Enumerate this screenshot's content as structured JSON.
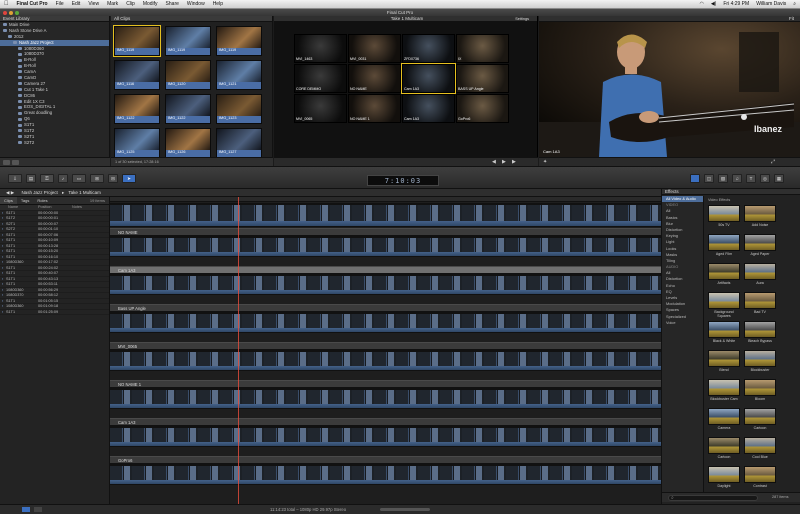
{
  "menubar": {
    "app": "Final Cut Pro",
    "items": [
      "File",
      "Edit",
      "View",
      "Mark",
      "Clip",
      "Modify",
      "Share",
      "Window",
      "Help"
    ],
    "clock": "Fri 4:29 PM",
    "user": "William Davis"
  },
  "window_title": "Final Cut Pro",
  "library": {
    "header": "Event Library",
    "items": [
      {
        "label": "Main Drive",
        "level": 0
      },
      {
        "label": "Nash Stone Drive A",
        "level": 0
      },
      {
        "label": "2012",
        "level": 1
      },
      {
        "label": "Nash Jazz Project",
        "level": 2,
        "selected": true
      },
      {
        "label": "1080D360",
        "level": 3
      },
      {
        "label": "1080D370",
        "level": 3
      },
      {
        "label": "B-Roll",
        "level": 3
      },
      {
        "label": "B-Roll",
        "level": 3
      },
      {
        "label": "CamA",
        "level": 3
      },
      {
        "label": "CamD",
        "level": 3
      },
      {
        "label": "Camera 27",
        "level": 3
      },
      {
        "label": "Cut 1 Take 1",
        "level": 3
      },
      {
        "label": "DC86",
        "level": 3
      },
      {
        "label": "Edit 1X C3",
        "level": 3
      },
      {
        "label": "EOS_DIGITAL 1",
        "level": 3
      },
      {
        "label": "Great doodling",
        "level": 3
      },
      {
        "label": "Q6",
        "level": 3
      },
      {
        "label": "S1T1",
        "level": 3
      },
      {
        "label": "S1T2",
        "level": 3
      },
      {
        "label": "S2T1",
        "level": 3
      },
      {
        "label": "S2T2",
        "level": 3
      }
    ]
  },
  "browser": {
    "header": "All Clips",
    "clips": [
      {
        "label": "IMG_1119"
      },
      {
        "label": "IMG_1119"
      },
      {
        "label": "IMG_1119"
      },
      {
        "label": "IMG_1116"
      },
      {
        "label": "IMG_1120"
      },
      {
        "label": "IMG_1121"
      },
      {
        "label": "IMG_1122"
      },
      {
        "label": "IMG_1122"
      },
      {
        "label": "IMG_1123"
      },
      {
        "label": "IMG_1125"
      },
      {
        "label": "IMG_1126"
      },
      {
        "label": "IMG_1127"
      }
    ],
    "footer": "1 of 30 selected, 17:28:16"
  },
  "angle_viewer": {
    "header": "Take 1 Multicam",
    "settings": "Settings",
    "angles": [
      "MVI_1463",
      "MVI_0031",
      "ZFD0736",
      "IX",
      "CORE DEMMO",
      "NO NAME",
      "Cam 1A3",
      "BASS UP Angle",
      "MVI_0065",
      "NO NAME 1",
      "Cam 1A3",
      "GoPro6"
    ]
  },
  "viewer": {
    "zoom": "Fit",
    "angle_label": "Cam 1A3"
  },
  "toolbar": {
    "timecode": "7:10:03"
  },
  "timeline_path": {
    "project": "Nash Jazz Project",
    "clip": "Take 1 Multicam"
  },
  "index": {
    "tabs": [
      "Clips",
      "Tags",
      "Roles"
    ],
    "count": "19 items",
    "columns": [
      "Name",
      "Position",
      "Notes"
    ],
    "rows": [
      [
        "S1T1",
        "00:00:00:00"
      ],
      [
        "S1T2",
        "00:00:00:01"
      ],
      [
        "S2T1",
        "00:00:00:07"
      ],
      [
        "S2T2",
        "00:00:01:10"
      ],
      [
        "S1T1",
        "00:00:07:06"
      ],
      [
        "S1T1",
        "00:00:10:09"
      ],
      [
        "S1T1",
        "00:00:13:28"
      ],
      [
        "S1T1",
        "00:00:15:20"
      ],
      [
        "S1T1",
        "00:00:16:10"
      ],
      [
        "1080D360",
        "00:00:17:02"
      ],
      [
        "S1T1",
        "00:00:24:02"
      ],
      [
        "S1T1",
        "00:00:40:07"
      ],
      [
        "S1T1",
        "00:00:43:13"
      ],
      [
        "S1T1",
        "00:00:53:11"
      ],
      [
        "1080D360",
        "00:00:56:29"
      ],
      [
        "1080D370",
        "00:00:58:12"
      ],
      [
        "S1T1",
        "00:01:05:15"
      ],
      [
        "1080D360",
        "00:01:09:18"
      ],
      [
        "S1T1",
        "00:01:25:09"
      ]
    ]
  },
  "lanes": [
    "NO NAME",
    "Cam 1A3",
    "Bass UP Angle",
    "MVI_0065",
    "NO NAME 1",
    "Cam 1A3",
    "GoPro6"
  ],
  "effects": {
    "header": "Effects",
    "categories": [
      "All Video & Audio",
      "VIDEO",
      "All",
      "Basics",
      "Blur",
      "Distortion",
      "Keying",
      "Light",
      "Looks",
      "Masks",
      "Tiling",
      "AUDIO",
      "All",
      "Distortion",
      "Echo",
      "EQ",
      "Levels",
      "Modulation",
      "Spaces",
      "Specialized",
      "Voice"
    ],
    "subheader": "Video Effects",
    "items": [
      "50s TV",
      "Add Noise",
      "Aged Film",
      "Aged Paper",
      "Artifacts",
      "Aura",
      "Background Squares",
      "Bad TV",
      "Black & White",
      "Bleach Bypass",
      "Blend",
      "Blockbuster",
      "Blockbuster Cam",
      "Bloom",
      "Camera",
      "Cartoon",
      "Cartoon",
      "Cool Blue",
      "Daylight",
      "Contrast"
    ],
    "count": "287 items"
  },
  "bottom": {
    "status": "11:14:23 total – 1080p HD 29.97p Stereo"
  }
}
